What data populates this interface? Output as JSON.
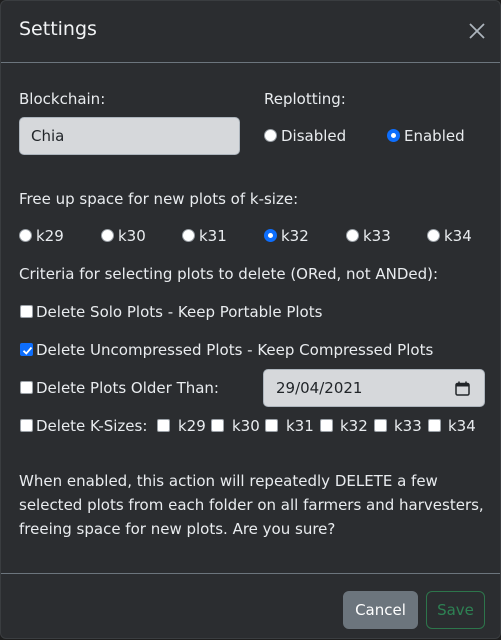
{
  "header": {
    "title": "Settings",
    "close_icon": "close-icon"
  },
  "blockchain": {
    "label": "Blockchain:",
    "value": "Chia"
  },
  "replotting": {
    "label": "Replotting:",
    "options": [
      {
        "label": "Disabled",
        "checked": false
      },
      {
        "label": "Enabled",
        "checked": true
      }
    ]
  },
  "ksize": {
    "label": "Free up space for new plots of k-size:",
    "options": [
      {
        "label": "k29",
        "checked": false
      },
      {
        "label": "k30",
        "checked": false
      },
      {
        "label": "k31",
        "checked": false
      },
      {
        "label": "k32",
        "checked": true
      },
      {
        "label": "k33",
        "checked": false
      },
      {
        "label": "k34",
        "checked": false
      }
    ]
  },
  "criteria": {
    "label": "Criteria for selecting plots to delete (ORed, not ANDed):",
    "solo": {
      "label": "Delete Solo Plots - Keep Portable Plots",
      "checked": false
    },
    "uncompressed": {
      "label": "Delete Uncompressed Plots - Keep Compressed Plots",
      "checked": true
    },
    "older": {
      "label": "Delete Plots Older Than:",
      "checked": false,
      "date": "29/04/2021",
      "calendar_icon": "calendar-icon"
    },
    "ksizes": {
      "label": "Delete K-Sizes:",
      "checked": false,
      "options": [
        {
          "label": "k29",
          "checked": false
        },
        {
          "label": "k30",
          "checked": false
        },
        {
          "label": "k31",
          "checked": false
        },
        {
          "label": "k32",
          "checked": false
        },
        {
          "label": "k33",
          "checked": false
        },
        {
          "label": "k34",
          "checked": false
        }
      ]
    }
  },
  "warning": "When enabled, this action will repeatedly DELETE a few selected plots from each folder on all farmers and harvesters, freeing space for new plots. Are you sure?",
  "footer": {
    "cancel_label": "Cancel",
    "save_label": "Save"
  },
  "colors": {
    "accent": "#0d6efd",
    "background": "#2b2d30",
    "save": "#2e8b57",
    "cancel": "#6c757d"
  }
}
